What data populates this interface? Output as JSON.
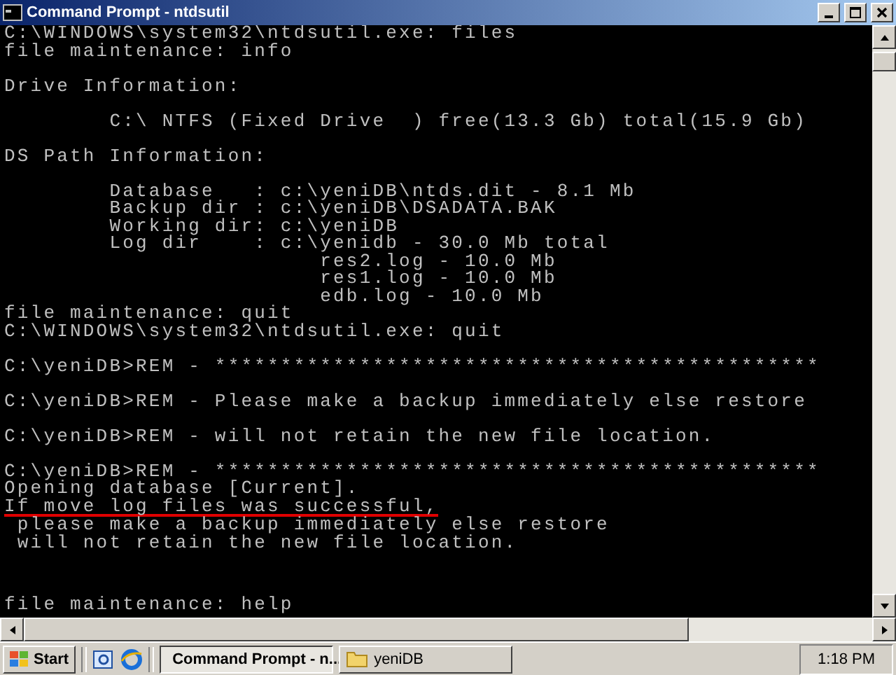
{
  "window": {
    "title": "Command Prompt - ntdsutil"
  },
  "console": {
    "blocks": [
      {
        "lines": [
          {
            "text": "C:\\WINDOWS\\system32\\ntdsutil.exe: files",
            "underlined": false
          },
          {
            "text": "file maintenance: info",
            "underlined": false
          }
        ]
      },
      {
        "lines": [
          {
            "text": "Drive Information:",
            "underlined": false
          }
        ]
      },
      {
        "lines": [
          {
            "text": "        C:\\ NTFS (Fixed Drive  ) free(13.3 Gb) total(15.9 Gb)",
            "underlined": false
          }
        ]
      },
      {
        "lines": [
          {
            "text": "DS Path Information:",
            "underlined": false
          }
        ]
      },
      {
        "lines": [
          {
            "text": "        Database   : c:\\yeniDB\\ntds.dit - 8.1 Mb",
            "underlined": false
          },
          {
            "text": "        Backup dir : c:\\yeniDB\\DSADATA.BAK",
            "underlined": false
          },
          {
            "text": "        Working dir: c:\\yeniDB",
            "underlined": false
          },
          {
            "text": "        Log dir    : c:\\yenidb - 30.0 Mb total",
            "underlined": false
          },
          {
            "text": "                        res2.log - 10.0 Mb",
            "underlined": false
          },
          {
            "text": "                        res1.log - 10.0 Mb",
            "underlined": false
          },
          {
            "text": "                        edb.log - 10.0 Mb",
            "underlined": false
          },
          {
            "text": "file maintenance: quit",
            "underlined": false
          },
          {
            "text": "C:\\WINDOWS\\system32\\ntdsutil.exe: quit",
            "underlined": false
          }
        ]
      },
      {
        "lines": [
          {
            "text": "C:\\yeniDB>REM - **********************************************",
            "underlined": false
          }
        ]
      },
      {
        "lines": [
          {
            "text": "C:\\yeniDB>REM - Please make a backup immediately else restore",
            "underlined": false
          }
        ]
      },
      {
        "lines": [
          {
            "text": "C:\\yeniDB>REM - will not retain the new file location.",
            "underlined": false
          }
        ]
      },
      {
        "lines": [
          {
            "text": "C:\\yeniDB>REM - **********************************************",
            "underlined": false
          },
          {
            "text": "Opening database [Current].",
            "underlined": false
          },
          {
            "text": "If move log files was successful,",
            "underlined": true
          },
          {
            "text": " please make a backup immediately else restore",
            "underlined": false
          },
          {
            "text": " will not retain the new file location.",
            "underlined": false
          }
        ]
      },
      {
        "lines": [
          {
            "text": "file maintenance: help",
            "underlined": false
          }
        ]
      }
    ]
  },
  "taskbar": {
    "start": "Start",
    "tasks": [
      {
        "label": "Command Prompt - n...",
        "kind": "console",
        "selected": true
      },
      {
        "label": "yeniDB",
        "kind": "folder",
        "selected": false
      }
    ],
    "clock": "1:18 PM"
  }
}
